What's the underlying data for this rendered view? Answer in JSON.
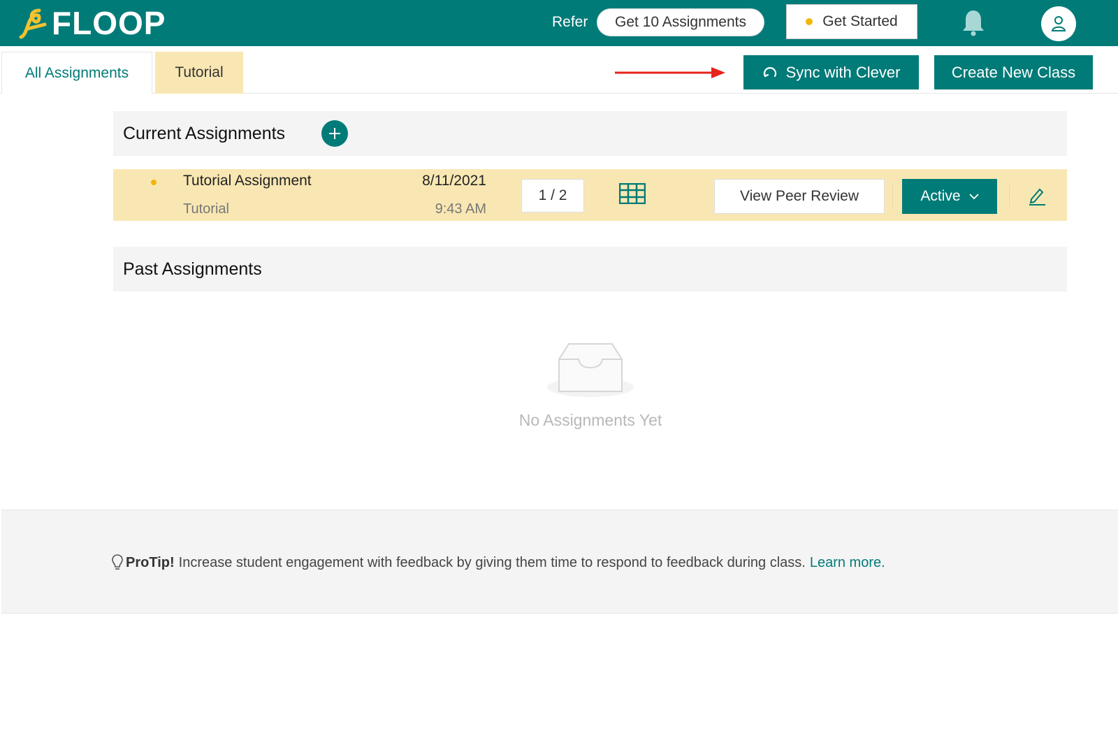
{
  "header": {
    "logo_text": "FLOOP",
    "refer_label": "Refer",
    "refer_button": "Get 10 Assignments",
    "get_started": "Get Started",
    "brand_color": "#007b78",
    "accent_color": "#f2b705"
  },
  "tabs": [
    {
      "label": "All Assignments",
      "selected": true
    },
    {
      "label": "Tutorial",
      "selected": false
    }
  ],
  "actions": {
    "sync_label": "Sync with Clever",
    "create_label": "Create New Class"
  },
  "current": {
    "title": "Current Assignments",
    "assignments": [
      {
        "title": "Tutorial Assignment",
        "class": "Tutorial",
        "date": "8/11/2021",
        "time": "9:43 AM",
        "count": "1 / 2",
        "peer_review_label": "View Peer Review",
        "status": "Active"
      }
    ]
  },
  "past": {
    "title": "Past Assignments",
    "empty_text": "No Assignments Yet"
  },
  "footer": {
    "tip_label": "ProTip!",
    "tip_text": "Increase student engagement with feedback by giving them time to respond to feedback during class.",
    "learn_more": "Learn more."
  }
}
